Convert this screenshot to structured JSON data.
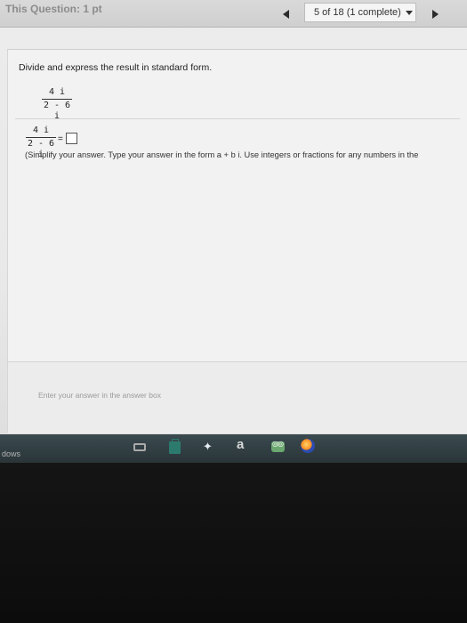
{
  "header": {
    "question_label": "This Question: 1 pt",
    "progress_label": "5 of 18 (1 complete)"
  },
  "question": {
    "prompt": "Divide and express the result in standard form.",
    "numerator": "4 i",
    "denominator": "2 - 6 i",
    "equals": "=",
    "instruction": "(Simplify your answer. Type your answer in the form a + b i.  Use integers or fractions for any numbers in the"
  },
  "answer_area": {
    "hint": "Enter your answer in the answer box"
  },
  "taskbar": {
    "label": "dows",
    "icons": [
      "task-view-icon",
      "store-icon",
      "dropbox-icon",
      "amazon-icon",
      "tripadvisor-icon",
      "firefox-icon"
    ],
    "amazon_glyph": "a",
    "dropbox_glyph": "✦"
  }
}
